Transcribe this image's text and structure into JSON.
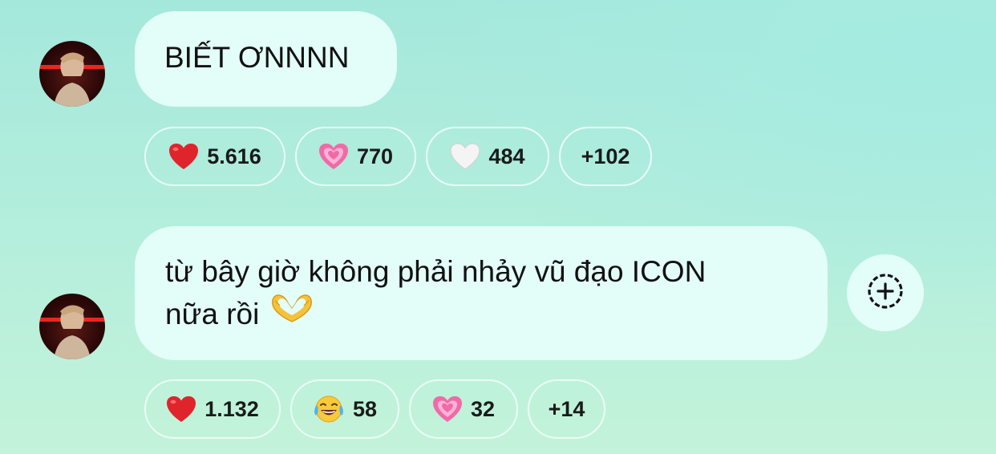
{
  "messages": [
    {
      "text": "BIẾT ƠNNNN",
      "reactions": [
        {
          "icon": "red-heart-icon",
          "count": "5.616"
        },
        {
          "icon": "sparkling-heart-icon",
          "count": "770"
        },
        {
          "icon": "white-heart-icon",
          "count": "484"
        }
      ],
      "more": "+102"
    },
    {
      "text_line1": "từ bây giờ không phải nhảy vũ đạo ICON",
      "text_line2": "nữa rồi",
      "reactions": [
        {
          "icon": "red-heart-icon",
          "count": "1.132"
        },
        {
          "icon": "tears-of-joy-icon",
          "count": "58"
        },
        {
          "icon": "sparkling-heart-icon",
          "count": "32"
        }
      ],
      "more": "+14"
    }
  ],
  "colors": {
    "bubble": "#e3fdf8",
    "background_top": "#a4e8dc",
    "background_bottom": "#c3f3da",
    "heart_red": "#e0242c",
    "heart_pink": "#f06aa8"
  }
}
